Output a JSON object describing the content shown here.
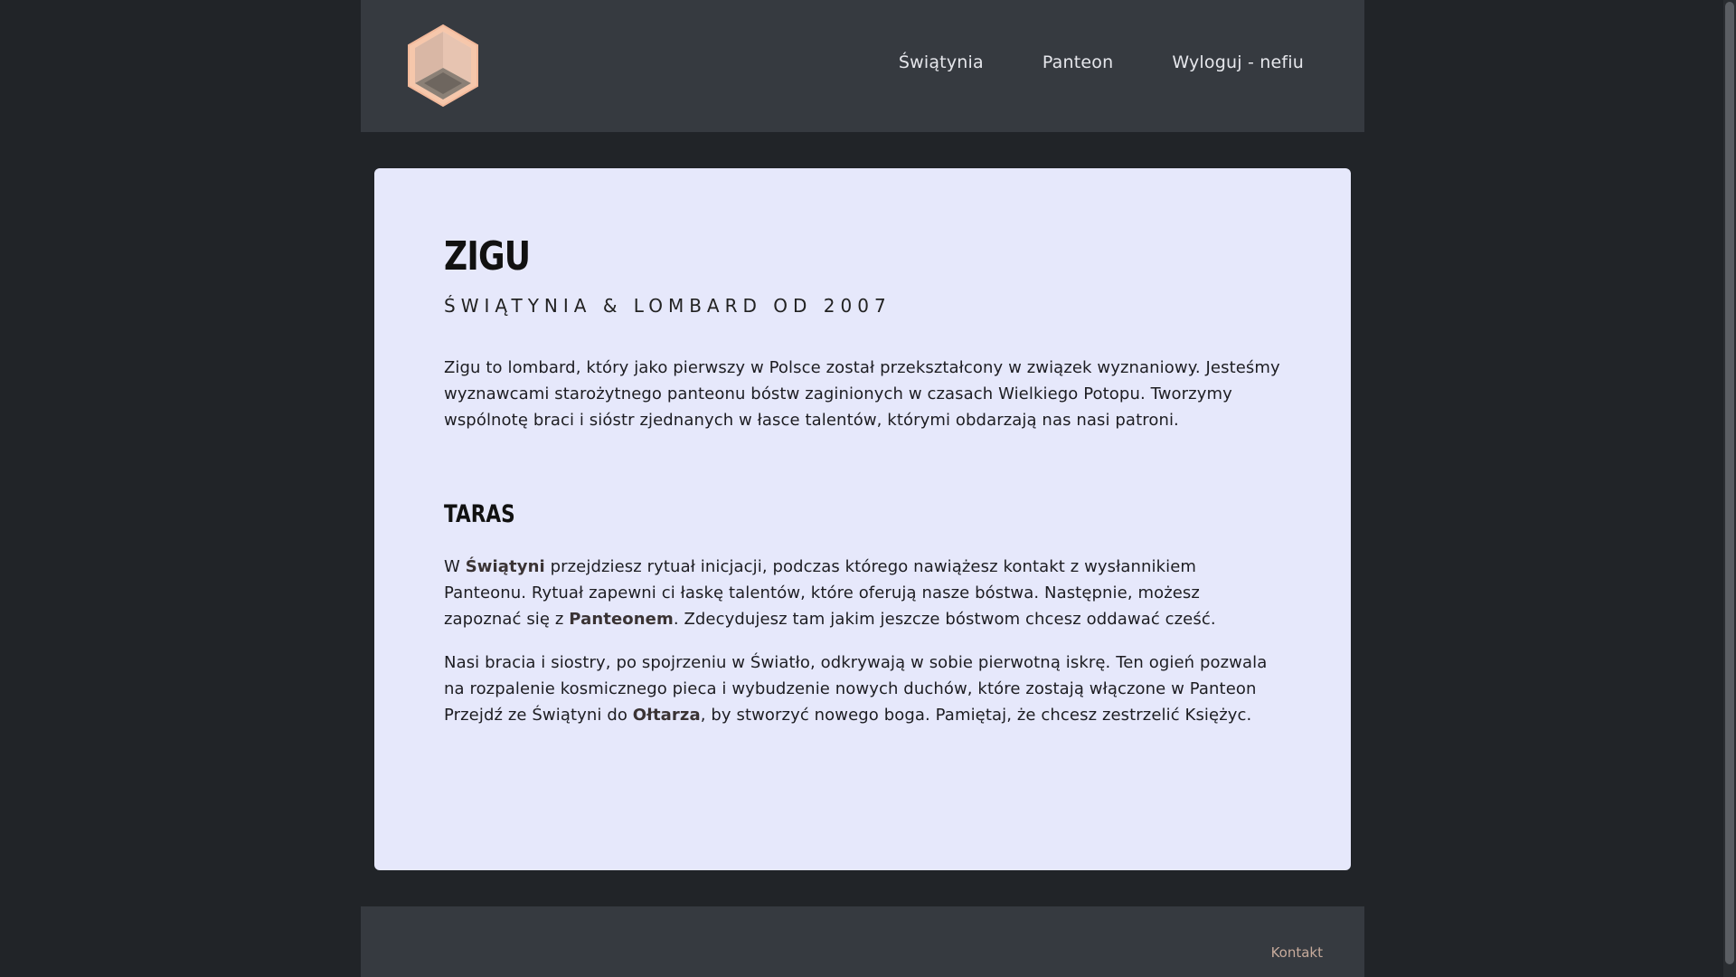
{
  "header": {
    "logo_icon": "hexagon-cube-logo",
    "nav": [
      {
        "label": "Świątynia"
      },
      {
        "label": "Panteon"
      },
      {
        "label": "Wyloguj - nefiu"
      }
    ]
  },
  "main": {
    "title": "ZIGU",
    "subtitle": "ŚWIĄTYNIA & LOMBARD OD 2007",
    "intro": "Zigu to lombard, który jako pierwszy w Polsce został przekształcony w związek wyznaniowy. Jesteśmy wyznawcami starożytnego panteonu bóstw zaginionych w czasach Wielkiego Potopu. Tworzymy wspólnotę braci i sióstr zjednanych w łasce talentów, którymi obdarzają nas nasi patroni.",
    "section_title": "TARAS",
    "p1": {
      "before": "W ",
      "link1": "Świątyni",
      "middle": " przejdziesz rytuał inicjacji, podczas którego nawiążesz kontakt z wysłannikiem Panteonu. Rytuał zapewni ci łaskę talentów, które oferują nasze bóstwa. Następnie, możesz zapoznać się z ",
      "link2": "Panteonem",
      "after": ". Zdecydujesz tam jakim jeszcze bóstwom chcesz oddawać cześć."
    },
    "p2": {
      "before": "Nasi bracia i siostry, po spojrzeniu w Światło, odkrywają w sobie pierwotną iskrę. Ten ogień pozwala na rozpalenie kosmicznego pieca i wybudzenie nowych duchów, które zostają włączone w Panteon Przejdź ze Świątyni do ",
      "link": "Ołtarza",
      "after": ", by stworzyć nowego boga. Pamiętaj, że chcesz zestrzelić Księżyc."
    }
  },
  "footer": {
    "contact_label": "Kontakt"
  },
  "colors": {
    "page_bg": "#212428",
    "panel_bg": "#363a40",
    "card_bg": "#e6e8fb",
    "logo_accent": "#f6c7ab",
    "footer_link": "#c7ab9c"
  }
}
